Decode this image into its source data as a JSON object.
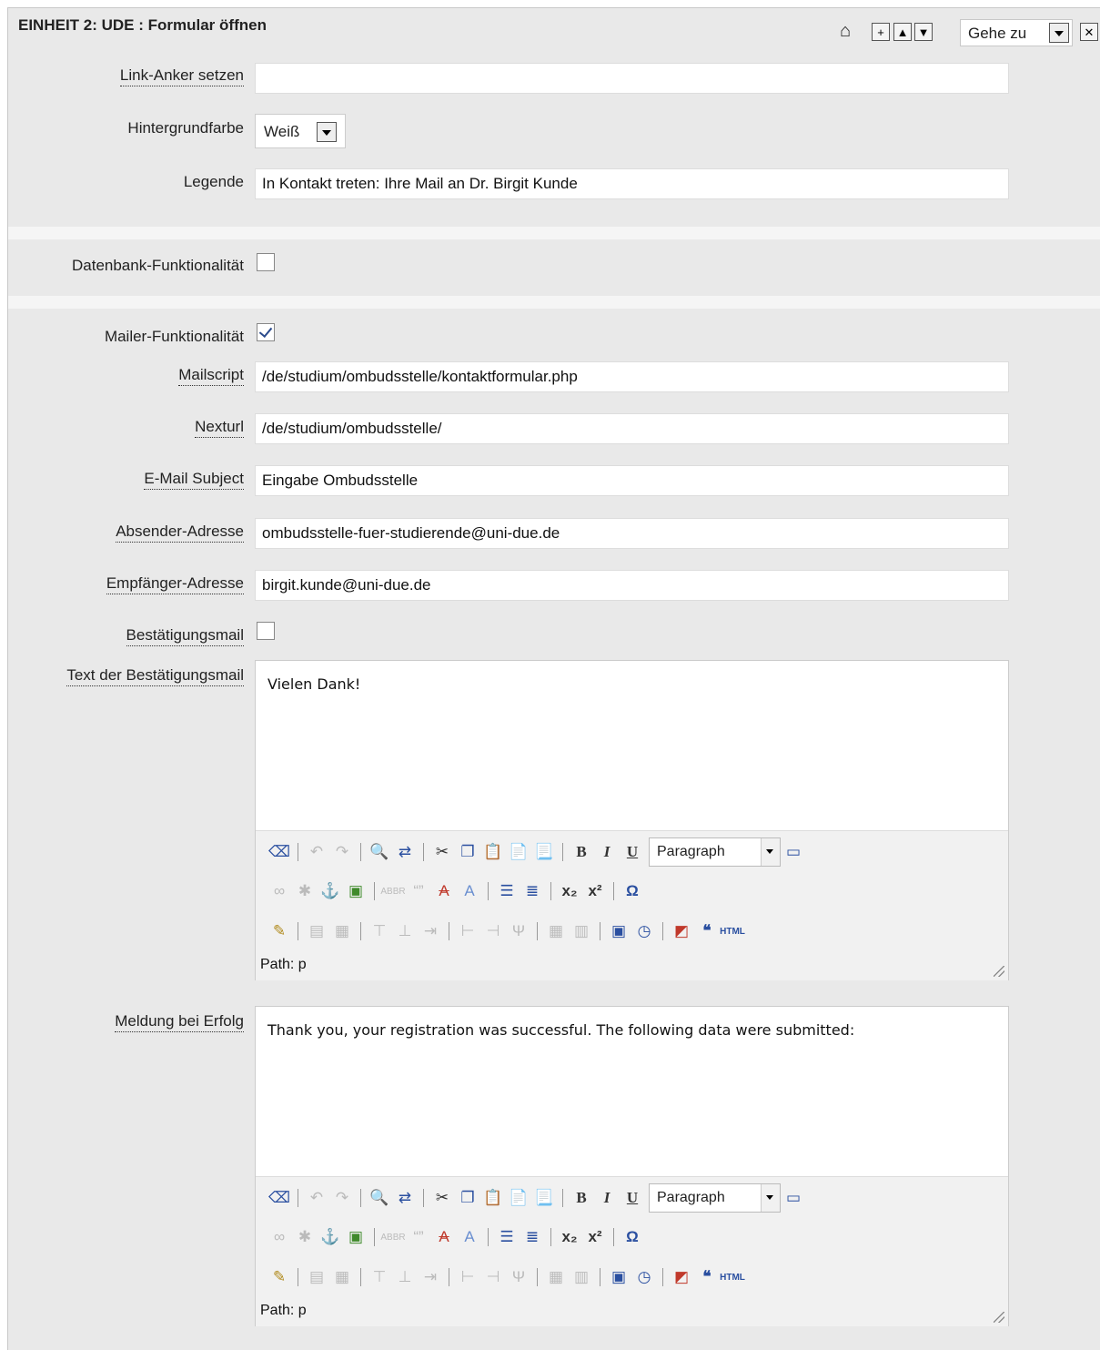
{
  "header": {
    "title": "EINHEIT 2: UDE : Formular öffnen",
    "goto_label": "Gehe zu"
  },
  "fields": {
    "link_anchor": {
      "label": "Link-Anker setzen",
      "value": ""
    },
    "background": {
      "label": "Hintergrundfarbe",
      "value": "Weiß"
    },
    "legend": {
      "label": "Legende",
      "value": "In Kontakt treten: Ihre Mail an Dr. Birgit Kunde"
    },
    "database": {
      "label": "Datenbank-Funktionalität",
      "checked": false
    },
    "mailer": {
      "label": "Mailer-Funktionalität",
      "checked": true
    },
    "mailscript": {
      "label": "Mailscript",
      "value": "/de/studium/ombudsstelle/kontaktformular.php"
    },
    "nexturl": {
      "label": "Nexturl",
      "value": "/de/studium/ombudsstelle/"
    },
    "subject": {
      "label": "E-Mail Subject",
      "value": "Eingabe Ombudsstelle"
    },
    "sender": {
      "label": "Absender-Adresse",
      "value": "ombudsstelle-fuer-studierende@uni-due.de"
    },
    "recipient": {
      "label": "Empfänger-Adresse",
      "value": "birgit.kunde@uni-due.de"
    },
    "confirmation": {
      "label": "Bestätigungsmail",
      "checked": false
    },
    "confirmation_text": {
      "label": "Text der Bestätigungsmail",
      "value": "Vielen Dank!"
    },
    "success_message": {
      "label": "Meldung bei Erfolg",
      "value": "Thank you, your registration was successful. The following data were submitted:"
    }
  },
  "editor": {
    "format_value": "Paragraph",
    "path_label": "Path: p",
    "html_label": "HTML"
  }
}
